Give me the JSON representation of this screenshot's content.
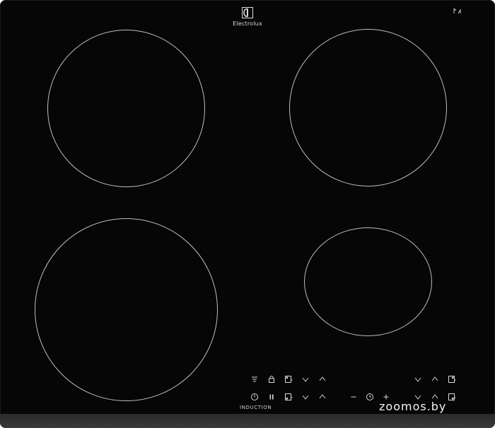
{
  "brand": {
    "name": "Electrolux",
    "icon": "electrolux-logo-icon"
  },
  "panel": {
    "label": "INDUCTION"
  },
  "watermark": {
    "text": "zoomos.by"
  },
  "colors": {
    "glass": "#060606",
    "ring": "#bdbdbd",
    "symbols": "#d8d8d8",
    "edge": "#333333"
  }
}
